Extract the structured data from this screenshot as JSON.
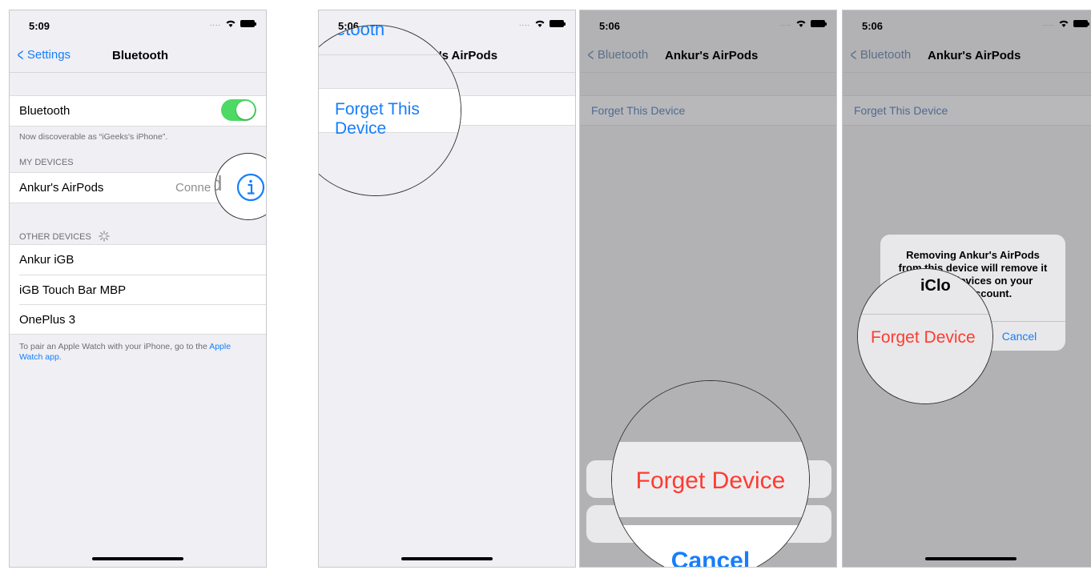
{
  "colors": {
    "ios_blue": "#157efb",
    "destructive_red": "#ff3b30",
    "toggle_green": "#4cd964"
  },
  "panel1": {
    "time": "5:09",
    "back_label": "Settings",
    "title": "Bluetooth",
    "bluetooth_label": "Bluetooth",
    "bluetooth_on": true,
    "discoverable_text": "Now discoverable as “iGeeks's iPhone”.",
    "my_devices_header": "MY DEVICES",
    "my_device_name": "Ankur's AirPods",
    "my_device_status": "Conne",
    "magnified_status": "d",
    "other_devices_header": "OTHER DEVICES",
    "other_devices": [
      {
        "name": "Ankur iGB"
      },
      {
        "name": "iGB Touch Bar MBP"
      },
      {
        "name": "OnePlus 3"
      }
    ],
    "footer_text": "To pair an Apple Watch with your iPhone, go to the ",
    "footer_link": "Apple Watch app",
    "footer_end": "."
  },
  "panel2": {
    "time": "5:06",
    "title_partial": "'s AirPods",
    "magnified_back": "etooth",
    "magnified_action": "Forget This Device"
  },
  "panel3": {
    "time": "5:06",
    "back_label": "Bluetooth",
    "title": "Ankur's AirPods",
    "forget_cell": "Forget This Device",
    "magnified_forget": "Forget Device",
    "magnified_cancel": "Cancel"
  },
  "panel4": {
    "time": "5:06",
    "back_label": "Bluetooth",
    "title": "Ankur's AirPods",
    "forget_cell": "Forget This Device",
    "alert_line1": "Removing Ankur's AirPods",
    "alert_line2": "from this device will remove it",
    "alert_line3": "from all devices on your",
    "alert_line4": "iCloud account.",
    "magnified_partial": "iClo",
    "magnified_forget": "Forget Device",
    "cancel_label": "Cancel"
  }
}
